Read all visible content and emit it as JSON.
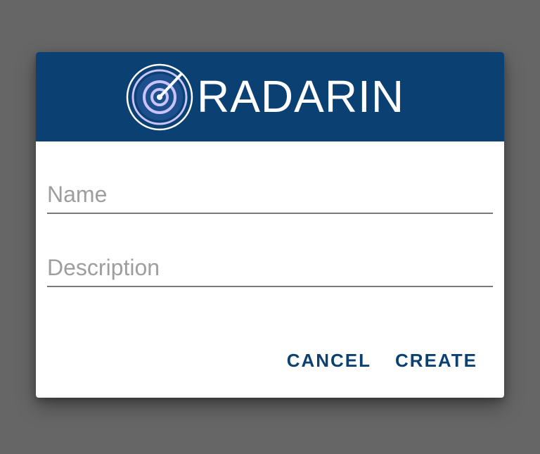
{
  "dialog": {
    "brand": {
      "name": "RADARIN",
      "logo_icon": "radar-icon",
      "header_color": "#0b4072"
    },
    "fields": {
      "name": {
        "placeholder": "Name",
        "value": ""
      },
      "description": {
        "placeholder": "Description",
        "value": ""
      }
    },
    "actions": {
      "cancel_label": "CANCEL",
      "create_label": "CREATE",
      "accent_color": "#0b4072"
    }
  }
}
